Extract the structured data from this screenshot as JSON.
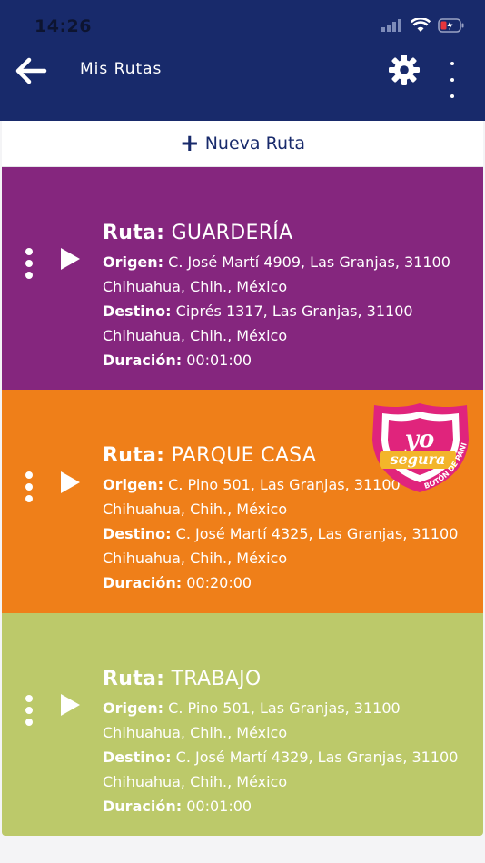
{
  "status": {
    "time": "14:26"
  },
  "header": {
    "title": "Mis Rutas"
  },
  "new_route": {
    "label": "Nueva Ruta"
  },
  "routes": [
    {
      "name_label": "Ruta:",
      "name": "GUARDERÍA",
      "origin_label": "Origen:",
      "origin": "C. José Martí 4909, Las Granjas, 31100 Chihuahua, Chih., México",
      "destination_label": "Destino:",
      "destination": "Ciprés 1317, Las Granjas, 31100 Chihuahua, Chih., México",
      "duration_label": "Duración:",
      "duration": "00:01:00",
      "color": "#85267e"
    },
    {
      "name_label": "Ruta:",
      "name": "PARQUE CASA",
      "origin_label": "Origen:",
      "origin": "C. Pino 501, Las Granjas, 31100 Chihuahua, Chih., México",
      "destination_label": "Destino:",
      "destination": "C. José Martí 4325, Las Granjas, 31100 Chihuahua, Chih., México",
      "duration_label": "Duración:",
      "duration": "00:20:00",
      "color": "#ef7f19"
    },
    {
      "name_label": "Ruta:",
      "name": "TRABAJO",
      "origin_label": "Origen:",
      "origin": "C. Pino 501, Las Granjas, 31100 Chihuahua, Chih., México",
      "destination_label": "Destino:",
      "destination": "C. José Martí 4329, Las Granjas, 31100 Chihuahua, Chih., México",
      "duration_label": "Duración:",
      "duration": "00:01:00",
      "color": "#bcc96a"
    }
  ],
  "badge": {
    "line1": "yo",
    "line2": "segura",
    "arc_text": "BOTÓN DE PÁNICO"
  },
  "icons": {
    "back": "arrow-left-icon",
    "settings": "gear-icon",
    "more": "more-vertical-icon",
    "add": "plus-icon",
    "route_menu": "kebab-icon",
    "play": "play-icon"
  }
}
